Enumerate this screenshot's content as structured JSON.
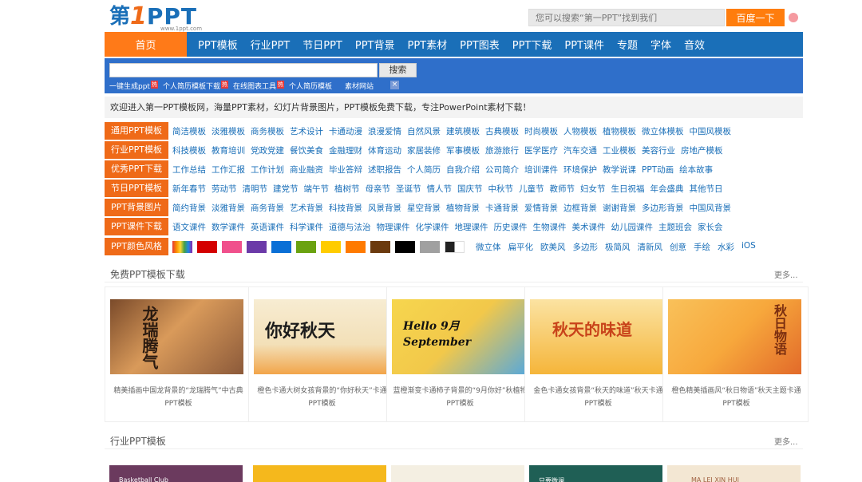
{
  "header": {
    "logo": {
      "char": "第",
      "num": "1",
      "text": "PPT",
      "url": "www.1ppt.com"
    },
    "search_placeholder": "您可以搜索“第一PPT”找到我们",
    "search_button": "百度一下"
  },
  "nav": {
    "home": "首页",
    "items": [
      "PPT模板",
      "行业PPT",
      "节日PPT",
      "PPT背景",
      "PPT素材",
      "PPT图表",
      "PPT下载",
      "PPT课件",
      "专题",
      "字体",
      "音效"
    ]
  },
  "search_panel": {
    "button": "搜索",
    "links": [
      {
        "label": "一键生成ppt",
        "hot": "热"
      },
      {
        "label": "个人简历模板下载",
        "hot": "热"
      },
      {
        "label": "在线图表工具",
        "hot": "热"
      },
      {
        "label": "个人简历模板",
        "hot": ""
      },
      {
        "label": "素材网站",
        "hot": ""
      }
    ],
    "close": "×"
  },
  "welcome": "欢迎进入第一PPT模板网，海量PPT素材，幻灯片背景图片，PPT模板免费下载，专注PowerPoint素材下载！",
  "categories": [
    {
      "tag": "通用PPT模板",
      "links": [
        "简洁模板",
        "淡雅模板",
        "商务模板",
        "艺术设计",
        "卡通动漫",
        "浪漫爱情",
        "自然风景",
        "建筑模板",
        "古典模板",
        "时尚模板",
        "人物模板",
        "植物模板",
        "微立体模板",
        "中国风模板"
      ]
    },
    {
      "tag": "行业PPT模板",
      "links": [
        "科技模板",
        "教育培训",
        "党政党建",
        "餐饮美食",
        "金融理财",
        "体育运动",
        "家居装修",
        "军事模板",
        "旅游旅行",
        "医学医疗",
        "汽车交通",
        "工业模板",
        "美容行业",
        "房地产模板"
      ]
    },
    {
      "tag": "优秀PPT下载",
      "links": [
        "工作总结",
        "工作汇报",
        "工作计划",
        "商业融资",
        "毕业答辩",
        "述职报告",
        "个人简历",
        "自我介绍",
        "公司简介",
        "培训课件",
        "环境保护",
        "教学说课",
        "PPT动画",
        "绘本故事"
      ]
    },
    {
      "tag": "节日PPT模板",
      "links": [
        "新年春节",
        "劳动节",
        "清明节",
        "建党节",
        "端午节",
        "植树节",
        "母亲节",
        "圣诞节",
        "情人节",
        "国庆节",
        "中秋节",
        "儿童节",
        "教师节",
        "妇女节",
        "生日祝福",
        "年会盛典",
        "其他节日"
      ]
    },
    {
      "tag": "PPT背景图片",
      "links": [
        "简约背景",
        "淡雅背景",
        "商务背景",
        "艺术背景",
        "科技背景",
        "风景背景",
        "星空背景",
        "植物背景",
        "卡通背景",
        "爱情背景",
        "边框背景",
        "谢谢背景",
        "多边形背景",
        "中国风背景"
      ]
    },
    {
      "tag": "PPT课件下载",
      "links": [
        "语文课件",
        "数学课件",
        "英语课件",
        "科学课件",
        "道德与法治",
        "物理课件",
        "化学课件",
        "地理课件",
        "历史课件",
        "生物课件",
        "美术课件",
        "幼儿园课件",
        "主题班会",
        "家长会"
      ]
    }
  ],
  "color_row": {
    "tag": "PPT颜色风格",
    "swatches": [
      "rainbow",
      "#d40000",
      "#f0508c",
      "#6b3aa8",
      "#0a6fd6",
      "#6aa210",
      "#ffcc00",
      "#ff7a00",
      "#6b3a0e",
      "#000000",
      "#a0a0a0",
      "black-white"
    ],
    "styles": [
      "微立体",
      "扁平化",
      "欧美风",
      "多边形",
      "极简风",
      "清新风",
      "创意",
      "手绘",
      "水彩",
      "iOS"
    ]
  },
  "section_free": {
    "title": "免费PPT模板下载",
    "more": "更多...",
    "cards": [
      {
        "thumb_text": "龙瑞腾气",
        "caption": "精美插画中国龙背景的“龙瑞腾气”中古典PPT模板",
        "bg": "#d99a5a"
      },
      {
        "thumb_text": "你好秋天",
        "caption": "橙色卡通大树女孩背景的“你好秋天”卡通PPT模板",
        "bg": "#f3e6c8"
      },
      {
        "thumb_text": "Hello 9月 September",
        "caption": "蓝橙渐变卡通柿子背景的“9月你好”秋植物PPT模板",
        "bg": "#f2c84a"
      },
      {
        "thumb_text": "秋天的味道",
        "caption": "金色卡通女孩背景“秋天的味道”秋天卡通PPT模板",
        "bg": "#f5b53a"
      },
      {
        "thumb_text": "秋日物语",
        "caption": "橙色精美插画风“秋日物语”秋天主题卡通PPT模板",
        "bg": "#f7a83c"
      }
    ]
  },
  "section_industry": {
    "title": "行业PPT模板",
    "more": "更多...",
    "cards": [
      {
        "thumb_text": "Basketball Club",
        "bg": "#6b3a5e"
      },
      {
        "thumb_text": "",
        "bg": "#f5b81c"
      },
      {
        "thumb_text": "",
        "bg": "#f4efe2"
      },
      {
        "thumb_text": "只要微澜",
        "bg": "#1f5f55"
      },
      {
        "thumb_text": "MA LEI XIN HUI",
        "bg": "#f3e7d3"
      }
    ]
  }
}
